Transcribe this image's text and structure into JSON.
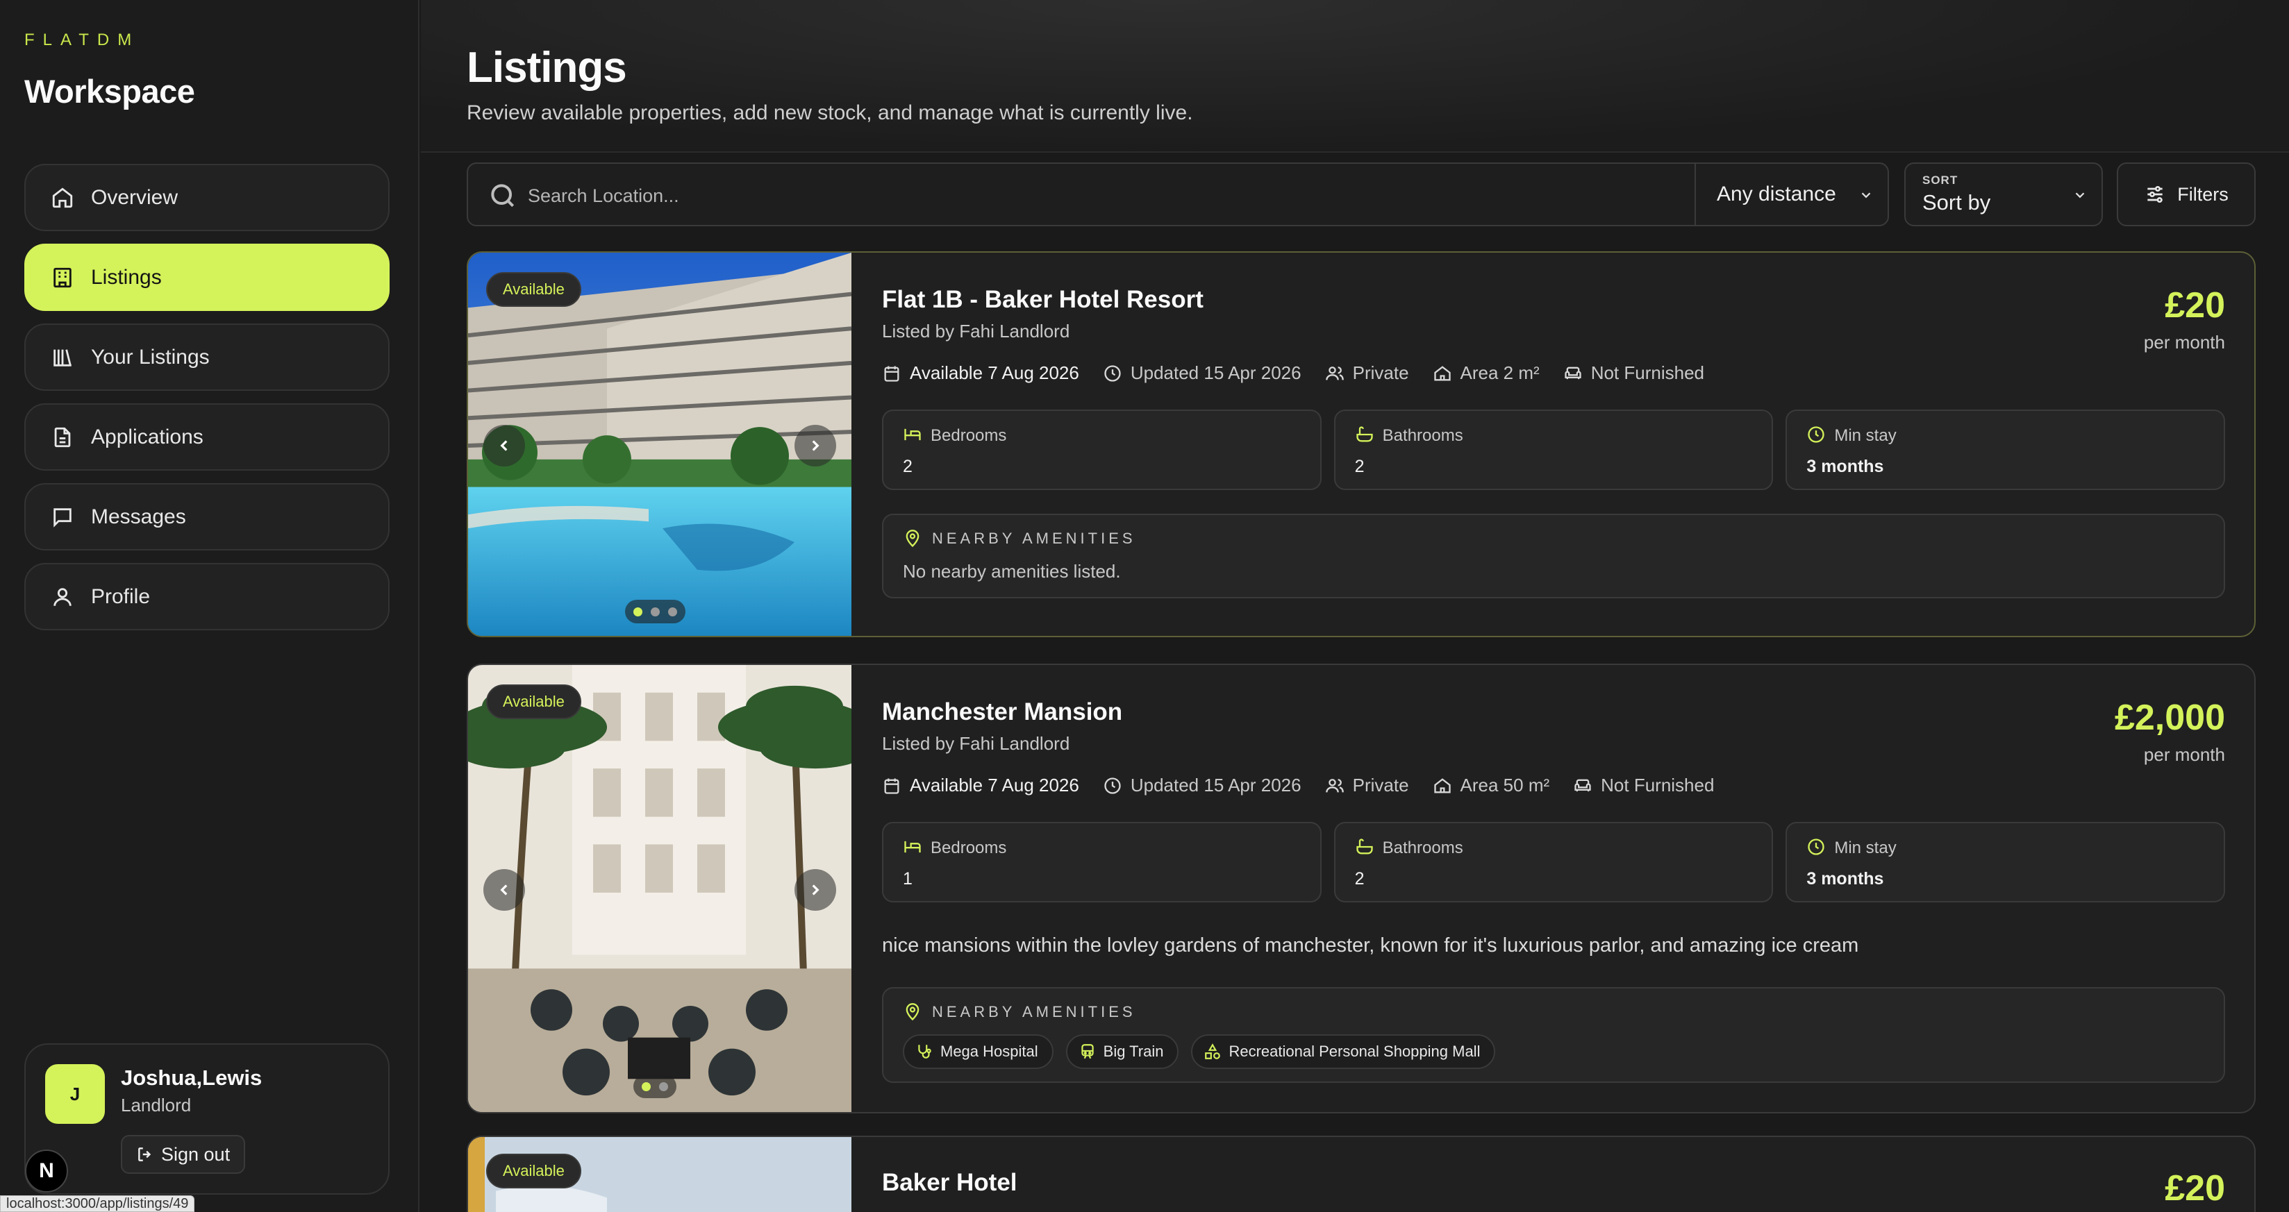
{
  "sidebar": {
    "brand": "FLATDM",
    "workspace": "Workspace",
    "items": [
      {
        "label": "Overview",
        "icon": "home-icon"
      },
      {
        "label": "Listings",
        "icon": "building-icon",
        "active": true
      },
      {
        "label": "Your Listings",
        "icon": "library-icon"
      },
      {
        "label": "Applications",
        "icon": "document-icon"
      },
      {
        "label": "Messages",
        "icon": "message-icon"
      },
      {
        "label": "Profile",
        "icon": "user-icon"
      }
    ],
    "user": {
      "initial": "J",
      "name": "Joshua,Lewis",
      "role": "Landlord",
      "signout": "Sign out"
    }
  },
  "status_url": "localhost:3000/app/listings/49",
  "next_badge": "N",
  "header": {
    "title": "Listings",
    "subtitle": "Review available properties, add new stock, and manage what is currently live."
  },
  "toolbar": {
    "search_placeholder": "Search Location...",
    "distance": "Any distance",
    "sort_caption": "SORT",
    "sort_value": "Sort by",
    "filters": "Filters"
  },
  "listings": [
    {
      "badge": "Available",
      "title": "Flat 1B - Baker Hotel Resort",
      "by": "Listed by Fahi Landlord",
      "price": "£20",
      "per": "per month",
      "available": "Available 7 Aug 2026",
      "updated": "Updated 15 Apr 2026",
      "type": "Private",
      "area": "Area 2 m²",
      "furnished": "Not Furnished",
      "stats": [
        {
          "label": "Bedrooms",
          "value": "2"
        },
        {
          "label": "Bathrooms",
          "value": "2"
        },
        {
          "label": "Min stay",
          "value": "3 months"
        }
      ],
      "amenities_heading": "NEARBY AMENITIES",
      "amenities_empty": "No nearby amenities listed."
    },
    {
      "badge": "Available",
      "title": "Manchester Mansion",
      "by": "Listed by Fahi Landlord",
      "price": "£2,000",
      "per": "per month",
      "available": "Available 7 Aug 2026",
      "updated": "Updated 15 Apr 2026",
      "type": "Private",
      "area": "Area 50 m²",
      "furnished": "Not Furnished",
      "stats": [
        {
          "label": "Bedrooms",
          "value": "1"
        },
        {
          "label": "Bathrooms",
          "value": "2"
        },
        {
          "label": "Min stay",
          "value": "3 months"
        }
      ],
      "description": "nice mansions within the lovley gardens of manchester, known for it's luxurious parlor, and amazing ice cream",
      "amenities_heading": "NEARBY AMENITIES",
      "amenities": [
        {
          "label": "Mega Hospital",
          "icon": "stethoscope-icon"
        },
        {
          "label": "Big Train",
          "icon": "train-icon"
        },
        {
          "label": "Recreational Personal Shopping Mall",
          "icon": "shapes-icon"
        }
      ]
    },
    {
      "badge": "Available",
      "title": "Baker Hotel",
      "price": "£20"
    }
  ],
  "colors": {
    "accent": "#d4f25a",
    "background": "#1a1a1a",
    "card": "#202020",
    "border": "#3a3a3a"
  }
}
